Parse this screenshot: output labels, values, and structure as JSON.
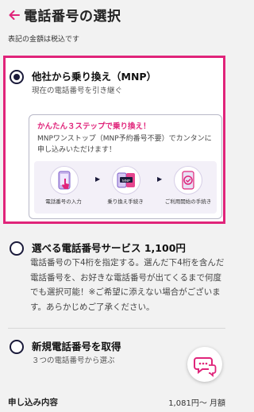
{
  "header": {
    "title": "電話番号の選択"
  },
  "tax_note": "表記の金額は税込です",
  "options": [
    {
      "title": "他社から乗り換え（MNP）",
      "subtitle": "現在の電話番号を引き継ぐ",
      "selected": true
    },
    {
      "title": "選べる電話番号サービス 1,100円",
      "description": "電話番号の下4桁を指定する。選んだ下4桁を含んだ電話番号を、お好きな電話番号が出てくるまで何度でも選択可能！※ご希望に添えない場合がございます。あらかじめご了承ください。",
      "selected": false
    },
    {
      "title": "新規電話番号を取得",
      "subtitle": "３つの電話番号から選ぶ",
      "selected": false
    }
  ],
  "mnp_steps": {
    "title": "かんたん３ステップで乗り換え！",
    "description": "MNPワンストップ（MNP予約番号不要）でカンタンに申し込みいただけます！",
    "steps": [
      {
        "label": "電話番号の入力",
        "icon": "phone-tap-icon"
      },
      {
        "label": "乗り換え手続き",
        "icon": "mnp-transfer-icon"
      },
      {
        "label": "ご利用開始の手続き",
        "icon": "phone-check-icon"
      }
    ]
  },
  "footer": {
    "label": "申し込み内容",
    "price": "1,081円〜 月額"
  },
  "colors": {
    "accent": "#e0247a",
    "navy": "#1a1a3a"
  }
}
